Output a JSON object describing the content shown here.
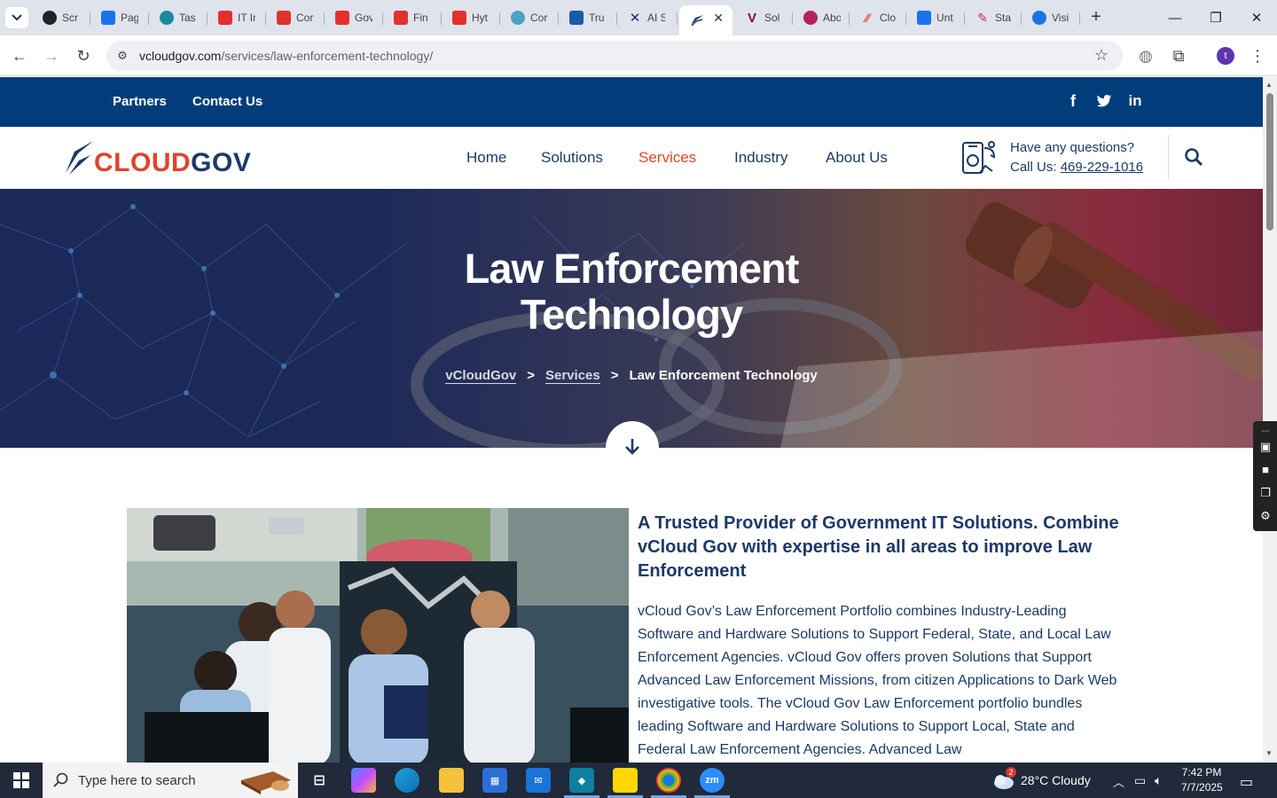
{
  "browser": {
    "tabs": [
      {
        "label": "Scr",
        "icon": "screencast-icon",
        "color": "#222222"
      },
      {
        "label": "Pag",
        "icon": "pagespeed-icon",
        "color": "#1a73e8"
      },
      {
        "label": "Tas",
        "icon": "task-icon",
        "color": "#1a8a9a"
      },
      {
        "label": "IT Ir",
        "icon": "pdf-icon",
        "color": "#e0312f"
      },
      {
        "label": "Cor",
        "icon": "pdf-icon",
        "color": "#e0312f"
      },
      {
        "label": "Gov",
        "icon": "pdf-icon",
        "color": "#e0312f"
      },
      {
        "label": "Fin",
        "icon": "pdf-icon",
        "color": "#e0312f"
      },
      {
        "label": "Hyt",
        "icon": "pdf-icon",
        "color": "#e0312f"
      },
      {
        "label": "Cor",
        "icon": "circle-icon",
        "color": "#4aa3c4"
      },
      {
        "label": "Tru",
        "icon": "scales-icon",
        "color": "#1a5aa8"
      },
      {
        "label": "AI S",
        "icon": "x-icon",
        "color": "#16306a"
      },
      {
        "label": "",
        "icon": "cloudgov-icon",
        "color": "#1b3a66"
      },
      {
        "label": "Sol",
        "icon": "v-icon",
        "color": "#8a1020"
      },
      {
        "label": "Abo",
        "icon": "abo-icon",
        "color": "#b0245a"
      },
      {
        "label": "Clo",
        "icon": "clo-icon",
        "color": "#e0442a"
      },
      {
        "label": "Unt",
        "icon": "doc-icon",
        "color": "#1a73e8"
      },
      {
        "label": "Sta",
        "icon": "sta-icon",
        "color": "#c81e7a"
      },
      {
        "label": "Visi",
        "icon": "visio-icon",
        "color": "#1a73e8"
      }
    ],
    "url_host": "vcloudgov.com",
    "url_path": "/services/law-enforcement-technology/",
    "profile_initial": "t"
  },
  "site": {
    "top_links": [
      "Partners",
      "Contact Us"
    ],
    "logo": "CLOUDGOV",
    "menu": [
      "Home",
      "Solutions",
      "Services",
      "Industry",
      "About Us"
    ],
    "active_menu": "Services",
    "questions": "Have any questions?",
    "call_prefix": "Call Us: ",
    "phone": "469-229-1016",
    "hero_title_1": "Law Enforcement",
    "hero_title_2": "Technology",
    "breadcrumb": [
      "vCloudGov",
      "Services",
      "Law Enforcement Technology"
    ],
    "breadcrumb_sep": ">",
    "heading": "A Trusted Provider of Government IT Solutions. Combine vCloud Gov with expertise in all areas to improve Law Enforcement",
    "paragraph": "vCloud Gov’s Law Enforcement Portfolio combines Industry-Leading Software and Hardware Solutions to Support Federal, State, and Local Law Enforcement Agencies. vCloud Gov offers proven Solutions that Support Advanced Law Enforcement Missions, from citizen Applications to Dark Web investigative tools. The vCloud Gov Law Enforcement portfolio bundles leading Software and Hardware Solutions to Support Local, State and Federal Law Enforcement Agencies. Advanced Law"
  },
  "colors": {
    "brand_navy": "#003d7a",
    "text_navy": "#1b3a66",
    "accent_red": "#e0442a"
  },
  "taskbar": {
    "search_placeholder": "Type here to search",
    "weather_badge": "2",
    "weather": "28°C  Cloudy",
    "time": "7:42 PM",
    "date": "7/7/2025"
  }
}
